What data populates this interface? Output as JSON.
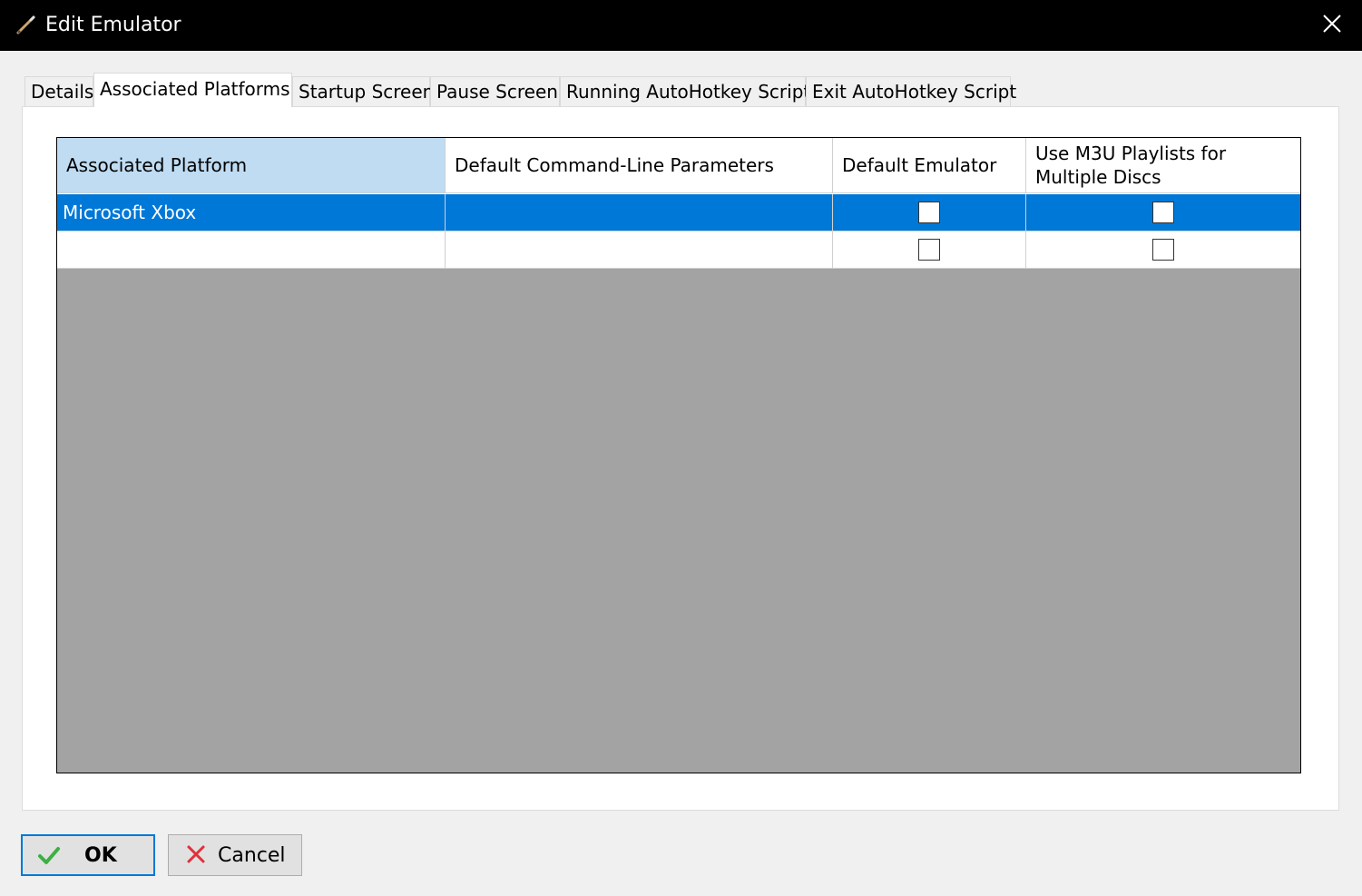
{
  "window": {
    "title": "Edit Emulator",
    "icon": "pencil-icon",
    "close_icon": "close-icon"
  },
  "tabs": [
    {
      "label": "Details",
      "active": false
    },
    {
      "label": "Associated Platforms",
      "active": true
    },
    {
      "label": "Startup Screen",
      "active": false
    },
    {
      "label": "Pause Screen",
      "active": false
    },
    {
      "label": "Running AutoHotkey Script",
      "active": false
    },
    {
      "label": "Exit AutoHotkey Script",
      "active": false
    }
  ],
  "grid": {
    "columns": [
      {
        "label": "Associated Platform"
      },
      {
        "label": "Default Command-Line Parameters"
      },
      {
        "label": "Default Emulator"
      },
      {
        "label": "Use M3U Playlists for Multiple Discs"
      }
    ],
    "rows": [
      {
        "platform": "Microsoft Xbox",
        "params": "",
        "default_emulator": false,
        "use_m3u": false,
        "selected": true
      },
      {
        "platform": "",
        "params": "",
        "default_emulator": false,
        "use_m3u": false,
        "selected": false
      }
    ]
  },
  "buttons": {
    "ok": {
      "label": "OK",
      "icon": "checkmark-icon"
    },
    "cancel": {
      "label": "Cancel",
      "icon": "x-icon"
    }
  },
  "colors": {
    "selection": "#0078d7",
    "header_selected": "#bfdcf2",
    "grid_empty": "#a3a3a3",
    "titlebar": "#000000"
  }
}
